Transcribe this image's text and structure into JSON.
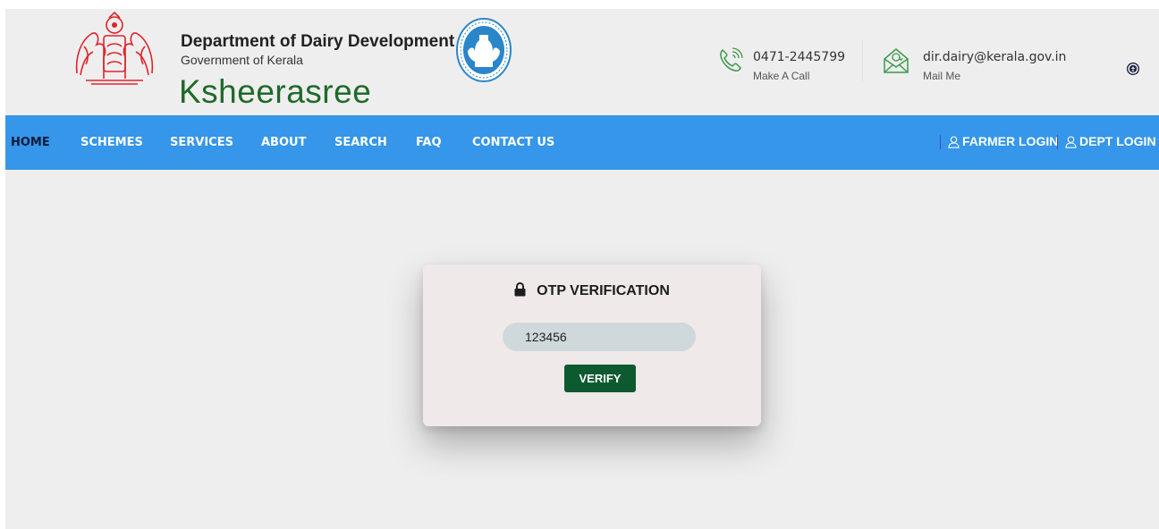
{
  "header": {
    "department_title": "Department of Dairy Development",
    "government": "Government of Kerala",
    "brand": "Ksheerasree",
    "phone_number": "0471-2445799",
    "phone_label": "Make A Call",
    "email": "dir.dairy@kerala.gov.in",
    "email_label": "Mail Me"
  },
  "nav": {
    "items": [
      "HOME",
      "SCHEMES",
      "SERVICES",
      "ABOUT",
      "SEARCH",
      "FAQ",
      "CONTACT US"
    ],
    "active": "HOME",
    "farmer_login": "FARMER LOGIN",
    "dept_login": "DEPT LOGIN"
  },
  "otp": {
    "title": "OTP VERIFICATION",
    "value": "123456",
    "verify_label": "VERIFY"
  },
  "colors": {
    "navbar": "#3596ea",
    "brand_green": "#1e6a2a",
    "verify_button": "#0d5a2f",
    "page_background": "#efeeee",
    "emblem_red": "#e0232b",
    "logo_blue": "#2b86c9"
  },
  "icons": [
    "kerala-emblem",
    "dairy-logo",
    "phone-icon",
    "mail-icon",
    "accessibility-icon",
    "user-icon",
    "lock-icon"
  ]
}
